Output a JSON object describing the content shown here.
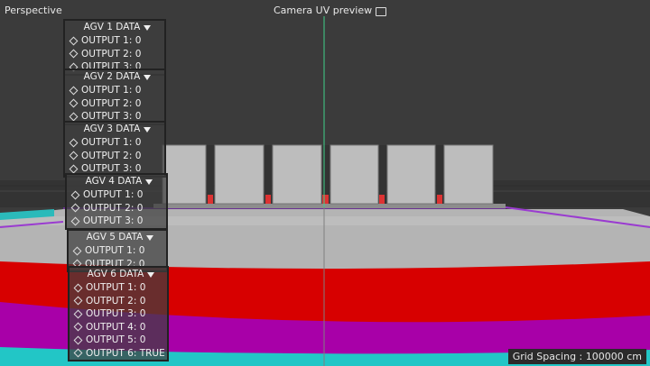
{
  "viewport": {
    "view_label": "Perspective",
    "camera_label": "Camera UV preview",
    "grid_spacing": "Grid Spacing : 100000 cm"
  },
  "panels": [
    {
      "title": "AGV 1 DATA",
      "rows": [
        "OUTPUT 1: 0",
        "OUTPUT 2: 0",
        "OUTPUT 3: 0"
      ]
    },
    {
      "title": "AGV 2 DATA",
      "rows": [
        "OUTPUT 1: 0",
        "OUTPUT 2: 0",
        "OUTPUT 3: 0"
      ]
    },
    {
      "title": "AGV 3 DATA",
      "rows": [
        "OUTPUT 1: 0",
        "OUTPUT 2: 0",
        "OUTPUT 3: 0"
      ]
    },
    {
      "title": "AGV 4 DATA",
      "rows": [
        "OUTPUT 1: 0",
        "OUTPUT 2: 0",
        "OUTPUT 3: 0"
      ]
    },
    {
      "title": "AGV 5 DATA",
      "rows": [
        "OUTPUT 1: 0",
        "OUTPUT 2: 0"
      ]
    },
    {
      "title": "AGV 6 DATA",
      "rows": [
        "OUTPUT 1: 0",
        "OUTPUT 2: 0",
        "OUTPUT 3: 0",
        "OUTPUT 4: 0",
        "OUTPUT 5: 0",
        "OUTPUT 6: TRUE"
      ]
    }
  ],
  "colors": {
    "background": "#3a3a3a",
    "floor": "#b3b3b3",
    "red_band": "#d90000",
    "magenta_band": "#c000c0",
    "cyan_band": "#1fb8b8",
    "green_axis": "#3fd08a",
    "box": "#bdbdbd"
  }
}
